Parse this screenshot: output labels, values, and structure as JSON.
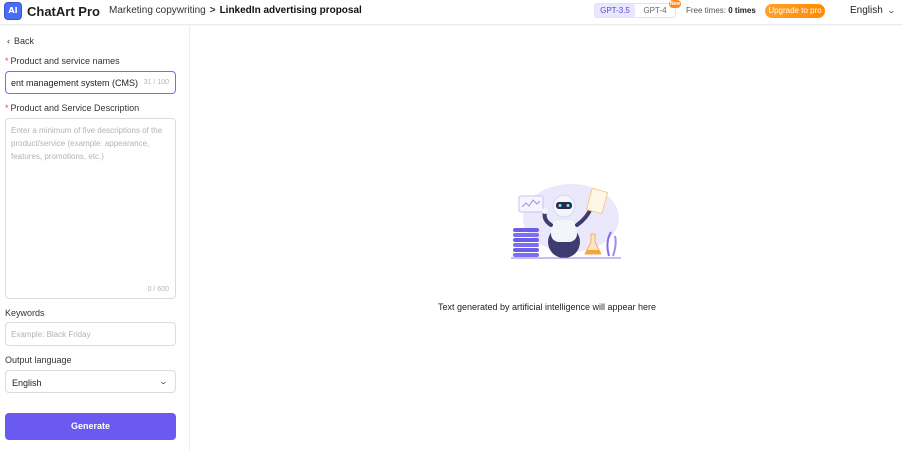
{
  "header": {
    "logo_icon_text": "AI",
    "app_name": "ChatArt Pro",
    "breadcrumb": {
      "parent": "Marketing copywriting",
      "separator": ">",
      "current": "LinkedIn advertising proposal"
    },
    "models": [
      {
        "label": "GPT-3.5",
        "active": true
      },
      {
        "label": "GPT-4",
        "active": false
      }
    ],
    "new_badge": "New",
    "free_times_label": "Free times:",
    "free_times_value": "0 times",
    "upgrade_label": "Upgrade to pro",
    "language": "English",
    "accent_color": "#6a5af2",
    "upgrade_color": "#ff8a00"
  },
  "sidebar": {
    "back_label": "Back",
    "product_name": {
      "label": "Product and service names",
      "required": "*",
      "value": "ent management system (CMS)",
      "count": "31 / 100"
    },
    "product_description": {
      "label": "Product and Service Description",
      "required": "*",
      "placeholder": "Enter a minimum of five descriptions of the product/service (example: appearance, features, promotions, etc.)",
      "count": "0 / 600"
    },
    "keywords": {
      "label": "Keywords",
      "placeholder": "Example: Black Friday"
    },
    "output_language": {
      "label": "Output language",
      "value": "English"
    },
    "generate_label": "Generate"
  },
  "main": {
    "illustration_icon": "robot-illustration",
    "empty_text": "Text generated by artificial intelligence will appear here"
  }
}
